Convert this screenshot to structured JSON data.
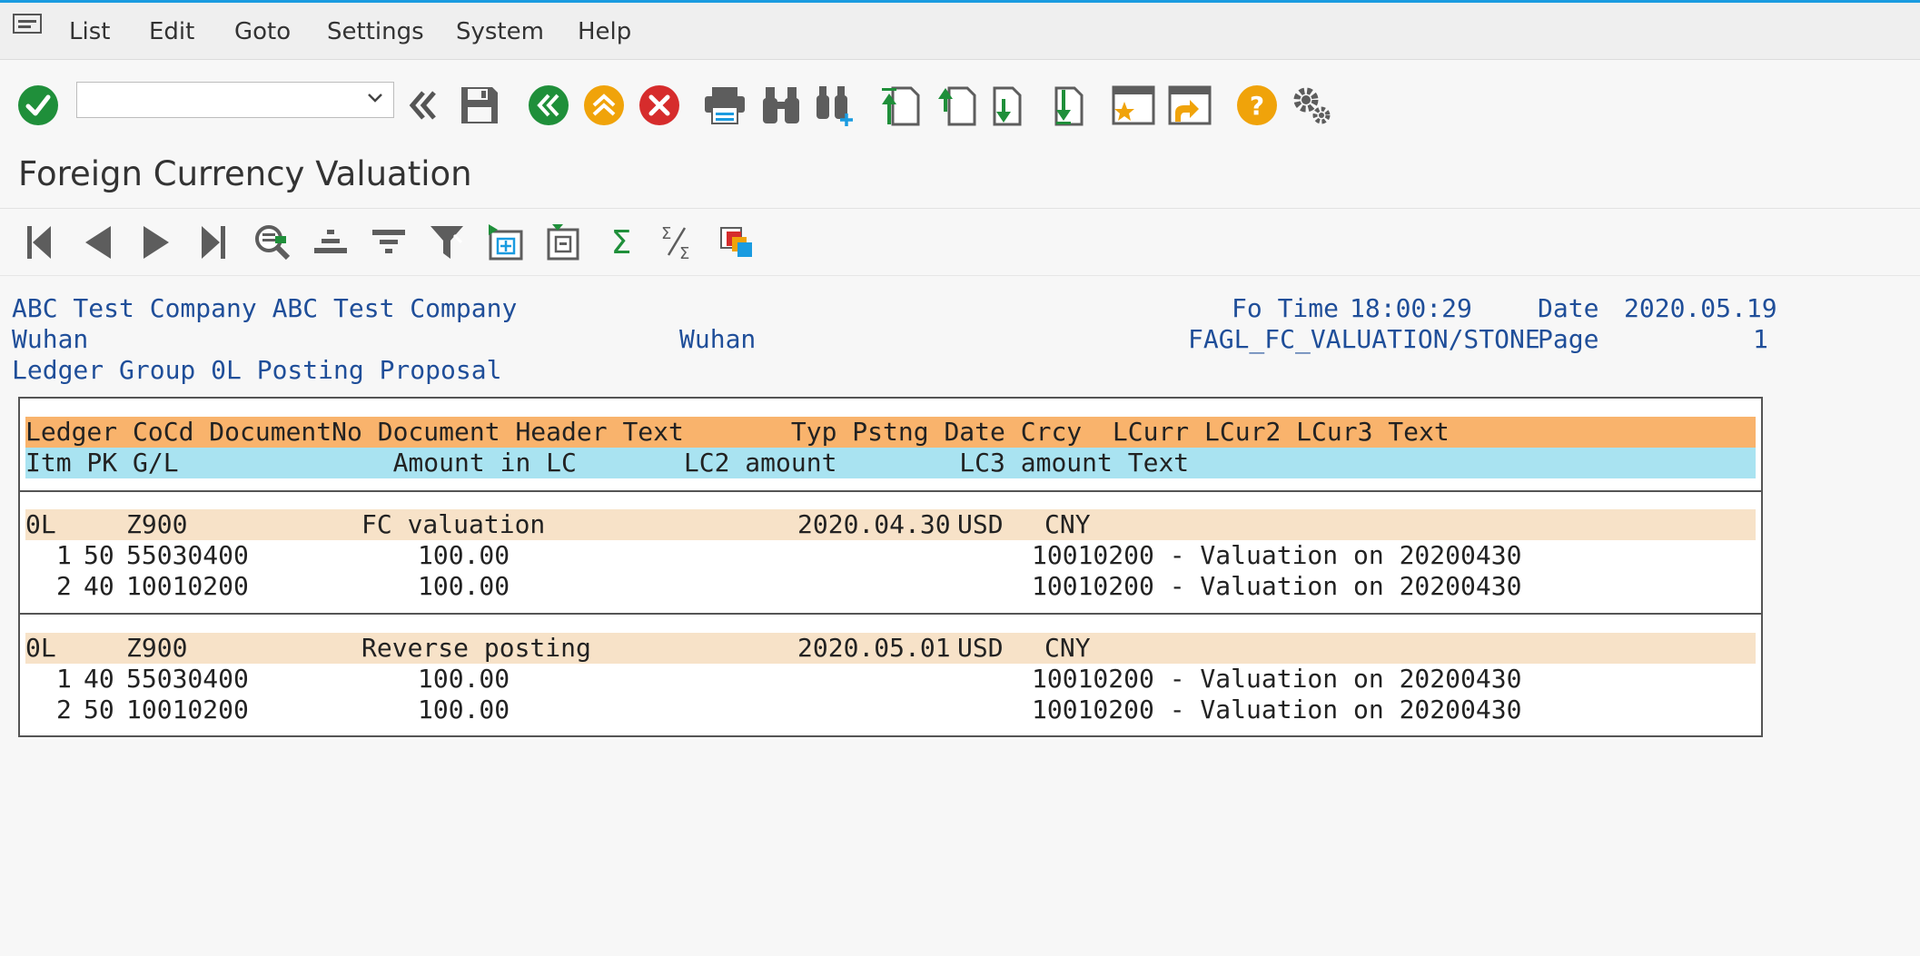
{
  "menu": {
    "items": [
      "List",
      "Edit",
      "Goto",
      "Settings",
      "System",
      "Help"
    ]
  },
  "toolbar": {
    "command_field_value": "",
    "icons": [
      "enter-icon",
      "back-double-icon",
      "save-icon",
      "back-icon",
      "exit-icon",
      "cancel-icon",
      "print-icon",
      "find-icon",
      "find-next-icon",
      "first-page-icon",
      "previous-page-icon",
      "next-page-icon",
      "last-page-icon",
      "new-session-icon",
      "shortcut-icon",
      "help-icon",
      "customize-icon"
    ],
    "colors": {
      "green": "#1f8f3a",
      "orange": "#f0a30a",
      "red": "#d62c2c",
      "gray": "#5d5d5d"
    }
  },
  "page": {
    "title": "Foreign Currency Valuation"
  },
  "alv_toolbar": {
    "icons": [
      "first-icon",
      "previous-icon",
      "next-icon",
      "last-icon",
      "details-icon",
      "sort-ascending-icon",
      "sort-descending-icon",
      "filter-icon",
      "export-icon",
      "layout-icon",
      "sum-icon",
      "subtotal-icon",
      "color-layout-icon"
    ],
    "sum_glyph": "Σ",
    "subtotal_glyph": "ᐟ/Σ"
  },
  "report_header": {
    "line1_left": "ABC Test Company ABC Test Company",
    "line1_right_time_label": "Fo Time",
    "line1_right_time": "18:00:29",
    "line1_right_date_label": "Date",
    "line1_right_date": "2020.05.19",
    "line2_left": "Wuhan",
    "line2_mid": "Wuhan",
    "line2_program": "FAGL_FC_VALUATION/STONE",
    "line2_page_label": "Page",
    "line2_page": "1",
    "line3": "Ledger Group 0L Posting Proposal"
  },
  "table": {
    "header1": "Ledger CoCd DocumentNo Document Header Text       Typ Pstng Date Crcy  LCurr LCur2 LCur3 Text",
    "header2": "Itm PK G/L              Amount in LC       LC2 amount        LC3 amount Text",
    "documents": [
      {
        "ledger": "0L",
        "cocd": "Z900",
        "header_text": "FC valuation",
        "date": "2020.04.30",
        "crcy": "USD",
        "lcurr": "CNY",
        "items": [
          {
            "itm": "1",
            "pk": "50",
            "gl": "55030400",
            "amount": "100.00",
            "text": "10010200 - Valuation on 20200430"
          },
          {
            "itm": "2",
            "pk": "40",
            "gl": "10010200",
            "amount": "100.00",
            "text": "10010200 - Valuation on 20200430"
          }
        ]
      },
      {
        "ledger": "0L",
        "cocd": "Z900",
        "header_text": "Reverse posting",
        "date": "2020.05.01",
        "crcy": "USD",
        "lcurr": "CNY",
        "items": [
          {
            "itm": "1",
            "pk": "40",
            "gl": "55030400",
            "amount": "100.00",
            "text": "10010200 - Valuation on 20200430"
          },
          {
            "itm": "2",
            "pk": "50",
            "gl": "10010200",
            "amount": "100.00",
            "text": "10010200 - Valuation on 20200430"
          }
        ]
      }
    ]
  }
}
